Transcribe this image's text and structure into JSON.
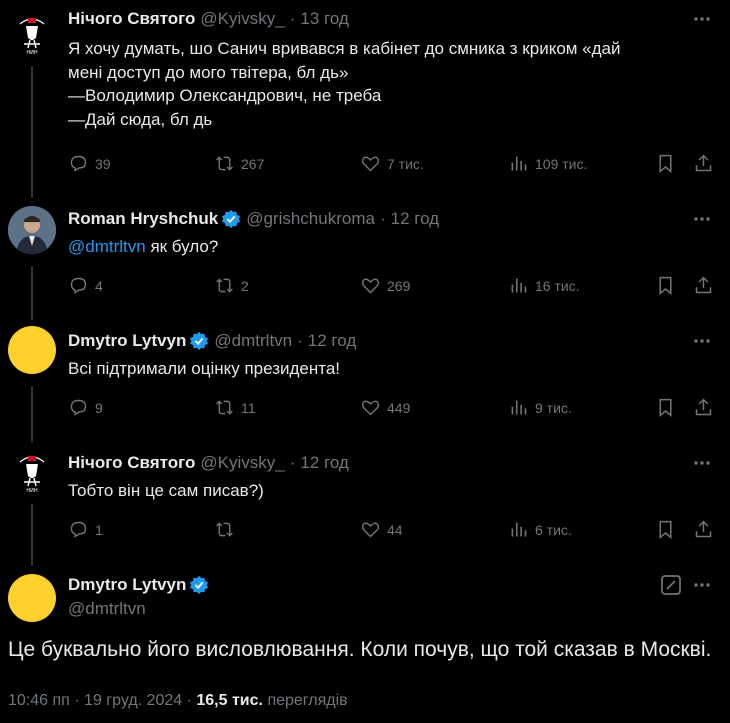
{
  "tweets": [
    {
      "name": "Нічого Святого",
      "handle": "@Kyivsky_",
      "time": "13 год",
      "text": "Я хочу думать, шо Санич вривався в кабінет до смника з криком «дай\nмені доступ до мого твітера, бл  дь»\n—Володимир Олександрович, не треба\n—Дай сюда, бл  дь",
      "replies": "39",
      "retweets": "267",
      "likes": "7 тис.",
      "views": "109 тис."
    },
    {
      "name": "Roman Hryshchuk",
      "handle": "@grishchukroma",
      "time": "12 год",
      "mention": "@dmtrltvn",
      "text": " як було?",
      "replies": "4",
      "retweets": "2",
      "likes": "269",
      "views": "16 тис."
    },
    {
      "name": "Dmytro Lytvyn",
      "handle": "@dmtrltvn",
      "time": "12 год",
      "text": "Всі підтримали оцінку президента!",
      "replies": "9",
      "retweets": "11",
      "likes": "449",
      "views": "9 тис."
    },
    {
      "name": "Нічого Святого",
      "handle": "@Kyivsky_",
      "time": "12 год",
      "text": "Тобто він це сам писав?)",
      "replies": "1",
      "retweets": "",
      "likes": "44",
      "views": "6 тис."
    }
  ],
  "main": {
    "name": "Dmytro Lytvyn",
    "handle": "@dmtrltvn",
    "text": "Це буквально його висловлювання. Коли почув, що той сказав в Москві.",
    "time": "10:46 пп",
    "date": "19 груд. 2024",
    "views_count": "16,5 тис.",
    "views_label": "переглядів"
  },
  "colors": {
    "accent": "#1d9bf0",
    "muted": "#71767b",
    "avatar_yellow": "#fed12c"
  },
  "icons": [
    "reply-icon",
    "retweet-icon",
    "like-icon",
    "views-icon",
    "bookmark-icon",
    "share-icon",
    "more-icon",
    "verified-icon",
    "grok-icon"
  ]
}
